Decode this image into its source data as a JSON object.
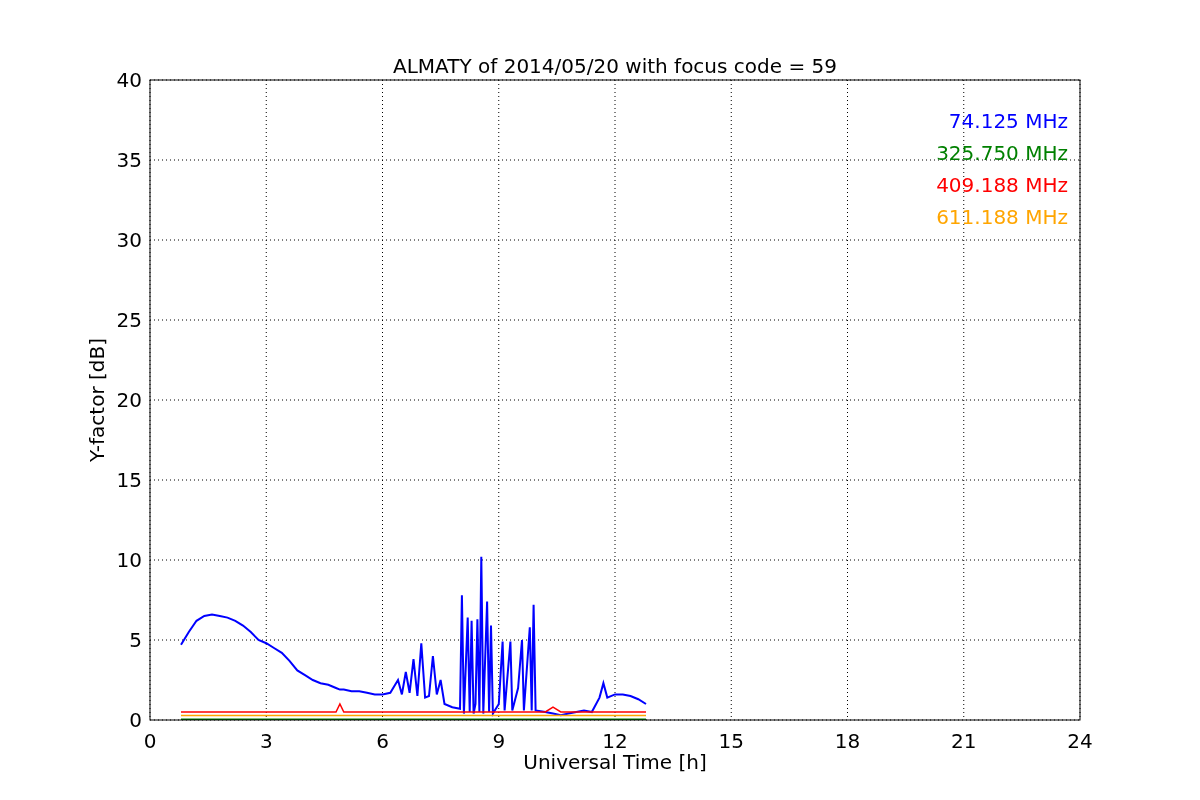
{
  "chart_data": {
    "type": "line",
    "title": "ALMATY of 2014/05/20 with focus code = 59",
    "xlabel": "Universal Time [h]",
    "ylabel": "Y-factor [dB]",
    "xlim": [
      0,
      24
    ],
    "ylim": [
      0,
      40
    ],
    "grid": true,
    "xticks": [
      0,
      3,
      6,
      9,
      12,
      15,
      18,
      21,
      24
    ],
    "yticks": [
      0,
      5,
      10,
      15,
      20,
      25,
      30,
      35,
      40
    ],
    "x": [
      0.8,
      1.0,
      1.2,
      1.4,
      1.6,
      1.8,
      2.0,
      2.2,
      2.4,
      2.6,
      2.8,
      3.0,
      3.2,
      3.4,
      3.6,
      3.8,
      4.0,
      4.2,
      4.4,
      4.6,
      4.8,
      4.9,
      5.0,
      5.2,
      5.4,
      5.6,
      5.8,
      6.0,
      6.2,
      6.4,
      6.5,
      6.6,
      6.7,
      6.8,
      6.9,
      7.0,
      7.1,
      7.2,
      7.3,
      7.4,
      7.5,
      7.6,
      7.8,
      8.0,
      8.05,
      8.1,
      8.2,
      8.25,
      8.3,
      8.35,
      8.4,
      8.45,
      8.5,
      8.55,
      8.6,
      8.7,
      8.75,
      8.8,
      8.85,
      9.0,
      9.1,
      9.15,
      9.3,
      9.35,
      9.5,
      9.6,
      9.65,
      9.8,
      9.85,
      9.9,
      9.95,
      10.2,
      10.4,
      10.6,
      10.8,
      11.0,
      11.2,
      11.4,
      11.6,
      11.7,
      11.8,
      12.0,
      12.2,
      12.4,
      12.6,
      12.8
    ],
    "series": [
      {
        "name": "74.125 MHz",
        "color": "#0000ff",
        "values": [
          4.7,
          5.5,
          6.2,
          6.5,
          6.6,
          6.5,
          6.4,
          6.2,
          5.9,
          5.5,
          5.0,
          4.8,
          4.5,
          4.2,
          3.7,
          3.1,
          2.8,
          2.5,
          2.3,
          2.2,
          2.0,
          1.9,
          1.9,
          1.8,
          1.8,
          1.7,
          1.6,
          1.6,
          1.7,
          2.5,
          1.6,
          3.0,
          1.7,
          3.8,
          1.5,
          4.8,
          1.4,
          1.5,
          4.0,
          1.6,
          2.5,
          1.0,
          0.8,
          0.7,
          7.8,
          0.4,
          6.4,
          0.5,
          6.2,
          0.4,
          1.0,
          6.3,
          0.5,
          10.2,
          0.4,
          7.4,
          0.5,
          5.9,
          0.4,
          1.0,
          4.9,
          0.6,
          4.9,
          0.6,
          2.0,
          5.0,
          0.6,
          5.8,
          0.6,
          7.2,
          0.6,
          0.5,
          0.4,
          0.3,
          0.4,
          0.5,
          0.6,
          0.5,
          1.4,
          2.3,
          1.4,
          1.6,
          1.6,
          1.5,
          1.3,
          1.0
        ]
      },
      {
        "name": "325.750 MHz",
        "color": "#008000",
        "values": [
          0.05,
          0.05,
          0.05,
          0.05,
          0.05,
          0.05,
          0.05,
          0.05,
          0.05,
          0.05,
          0.05,
          0.05,
          0.05,
          0.05,
          0.05,
          0.05,
          0.05,
          0.05,
          0.05,
          0.05,
          0.05,
          0.05,
          0.05,
          0.05,
          0.05,
          0.05,
          0.05,
          0.05,
          0.05,
          0.05,
          0.05,
          0.05,
          0.05,
          0.05,
          0.05,
          0.05,
          0.05,
          0.05,
          0.05,
          0.05,
          0.05,
          0.05,
          0.05,
          0.05,
          0.05,
          0.05,
          0.05,
          0.05,
          0.05,
          0.05,
          0.05,
          0.05,
          0.05,
          0.05,
          0.05,
          0.05,
          0.05,
          0.05,
          0.05,
          0.05,
          0.05,
          0.05,
          0.05,
          0.05,
          0.05,
          0.05,
          0.05,
          0.05,
          0.05,
          0.05,
          0.05,
          0.05,
          0.05,
          0.05,
          0.05,
          0.05,
          0.05,
          0.05,
          0.05,
          0.05,
          0.05,
          0.05,
          0.05,
          0.05,
          0.05,
          0.05
        ]
      },
      {
        "name": "409.188 MHz",
        "color": "#ff0000",
        "values": [
          0.5,
          0.5,
          0.5,
          0.5,
          0.5,
          0.5,
          0.5,
          0.5,
          0.5,
          0.5,
          0.5,
          0.5,
          0.5,
          0.5,
          0.5,
          0.5,
          0.5,
          0.5,
          0.5,
          0.5,
          0.5,
          1.0,
          0.5,
          0.5,
          0.5,
          0.5,
          0.5,
          0.5,
          0.5,
          0.5,
          0.5,
          0.5,
          0.5,
          0.5,
          0.5,
          0.5,
          0.5,
          0.5,
          0.5,
          0.5,
          0.5,
          0.5,
          0.5,
          0.5,
          0.5,
          0.5,
          0.5,
          0.5,
          0.5,
          0.5,
          0.5,
          0.5,
          0.5,
          0.5,
          0.5,
          0.5,
          0.5,
          0.5,
          0.5,
          0.5,
          0.5,
          0.5,
          0.5,
          0.5,
          0.5,
          0.5,
          0.5,
          0.5,
          0.5,
          0.5,
          0.5,
          0.5,
          0.8,
          0.5,
          0.5,
          0.5,
          0.5,
          0.5,
          0.5,
          0.5,
          0.5,
          0.5,
          0.5,
          0.5,
          0.5,
          0.5
        ]
      },
      {
        "name": "611.188 MHz",
        "color": "#ffa500",
        "values": [
          0.28,
          0.28,
          0.28,
          0.28,
          0.28,
          0.28,
          0.28,
          0.28,
          0.28,
          0.28,
          0.28,
          0.28,
          0.28,
          0.28,
          0.28,
          0.28,
          0.28,
          0.28,
          0.28,
          0.28,
          0.28,
          0.28,
          0.28,
          0.28,
          0.28,
          0.28,
          0.28,
          0.28,
          0.28,
          0.28,
          0.28,
          0.28,
          0.28,
          0.28,
          0.28,
          0.28,
          0.28,
          0.28,
          0.28,
          0.28,
          0.28,
          0.28,
          0.28,
          0.28,
          0.28,
          0.28,
          0.28,
          0.28,
          0.28,
          0.28,
          0.28,
          0.28,
          0.28,
          0.28,
          0.28,
          0.28,
          0.28,
          0.28,
          0.28,
          0.28,
          0.28,
          0.28,
          0.28,
          0.28,
          0.28,
          0.28,
          0.28,
          0.28,
          0.28,
          0.28,
          0.28,
          0.28,
          0.28,
          0.28,
          0.28,
          0.28,
          0.28,
          0.28,
          0.28,
          0.28,
          0.28,
          0.28,
          0.28,
          0.28,
          0.28,
          0.28
        ]
      }
    ]
  }
}
